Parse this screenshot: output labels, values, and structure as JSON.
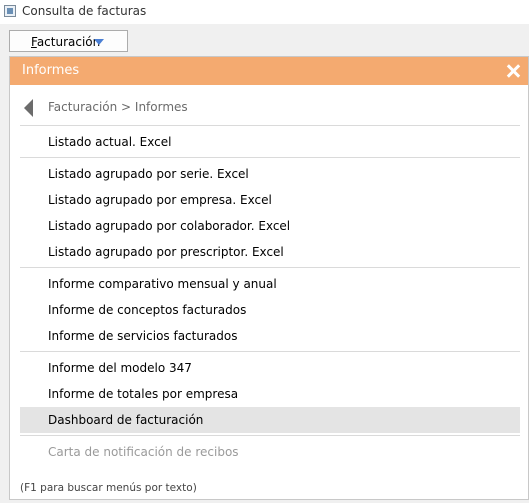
{
  "window": {
    "title": "Consulta de facturas"
  },
  "menu_button": {
    "label": "Facturación"
  },
  "panel": {
    "title": "Informes",
    "breadcrumb": "Facturación > Informes",
    "items": [
      {
        "label": "Listado actual. Excel"
      },
      {
        "label": "Listado agrupado por serie. Excel"
      },
      {
        "label": "Listado agrupado por empresa. Excel"
      },
      {
        "label": "Listado agrupado por colaborador. Excel"
      },
      {
        "label": "Listado agrupado por prescriptor. Excel"
      },
      {
        "label": "Informe comparativo mensual y anual"
      },
      {
        "label": "Informe de conceptos facturados"
      },
      {
        "label": "Informe de servicios facturados"
      },
      {
        "label": "Informe del modelo 347"
      },
      {
        "label": "Informe de totales por empresa"
      },
      {
        "label": "Dashboard de facturación",
        "highlighted": true
      },
      {
        "label": "Carta de notificación de recibos",
        "disabled": true
      }
    ],
    "hint": "(F1 para buscar menús por texto)"
  }
}
